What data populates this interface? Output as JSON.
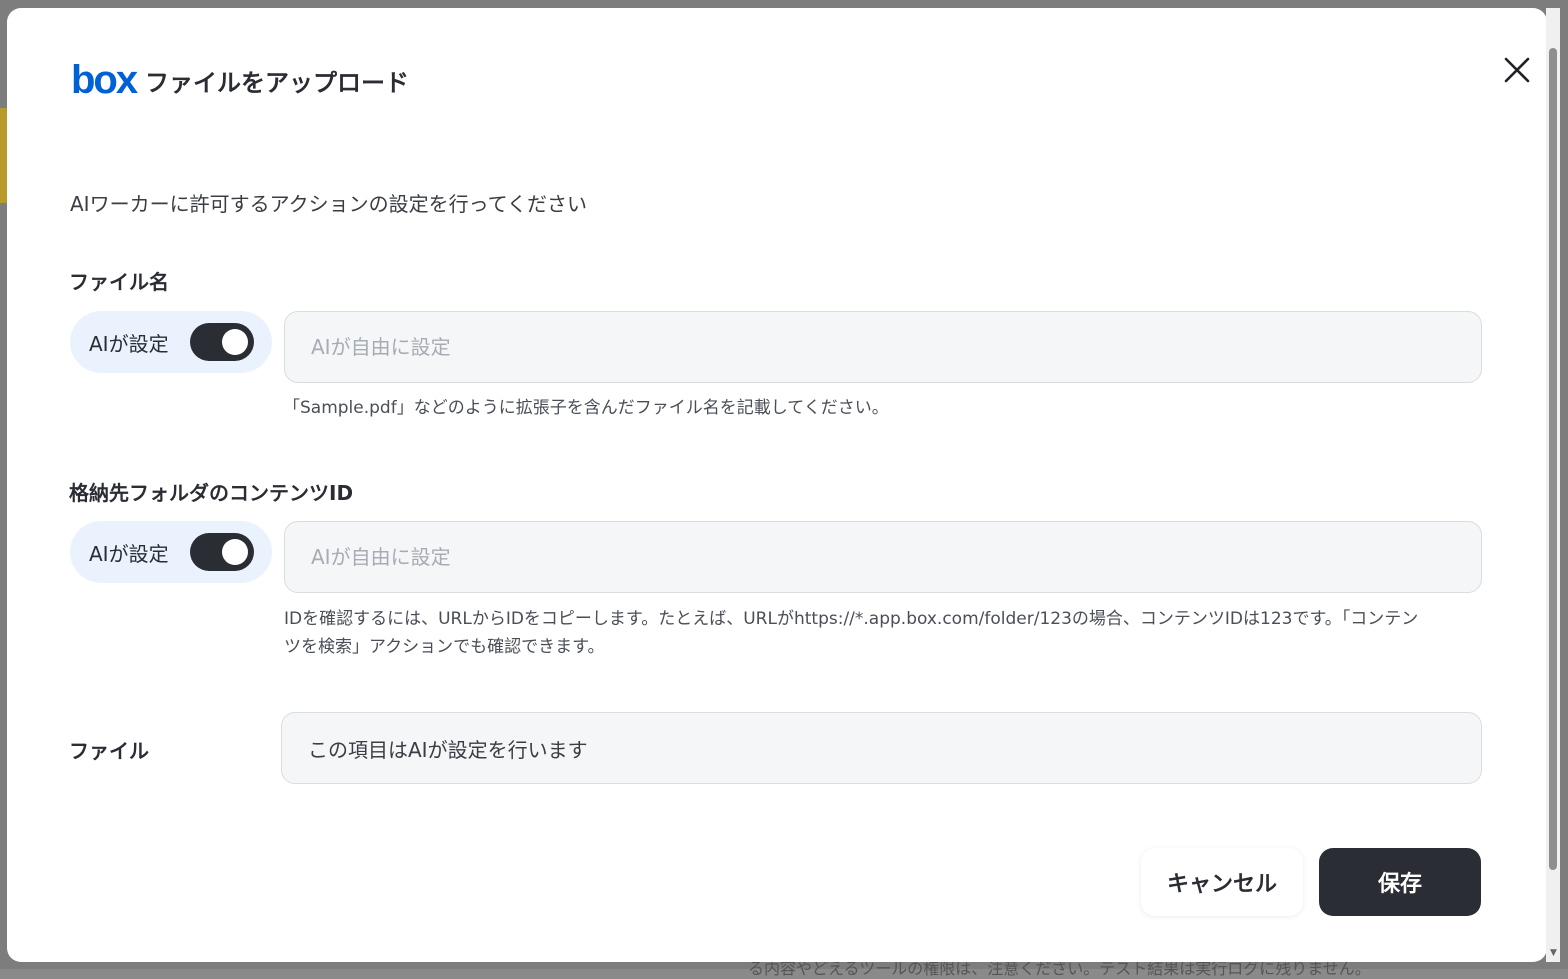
{
  "dialog": {
    "title": "ファイルをアップロード",
    "logo_text": "box",
    "description": "AIワーカーに許可するアクションの設定を行ってください",
    "close_icon": "close-icon"
  },
  "fields": {
    "file_name": {
      "label": "ファイル名",
      "ai_toggle_label": "AIが設定",
      "ai_toggle_on": true,
      "placeholder": "AIが自由に設定",
      "value": "",
      "hint": "「Sample.pdf」などのように拡張子を含んだファイル名を記載してください。"
    },
    "folder_id": {
      "label": "格納先フォルダのコンテンツID",
      "ai_toggle_label": "AIが設定",
      "ai_toggle_on": true,
      "placeholder": "AIが自由に設定",
      "value": "",
      "hint_line1": "IDを確認するには、URLからIDをコピーします。たとえば、URLがhttps://*.app.box.com/folder/123の場合、コンテンツIDは123です。「コンテン",
      "hint_line2": "ツを検索」アクションでも確認できます。"
    },
    "file": {
      "label": "ファイル",
      "readonly_text": "この項目はAIが設定を行います"
    }
  },
  "footer": {
    "cancel_label": "キャンセル",
    "save_label": "保存"
  },
  "background": {
    "partial_text": "る内容やどえるツールの権限は、注意ください。テスト結果は実行ログに残りません。"
  },
  "colors": {
    "brand_blue": "#0061d5",
    "primary_dark": "#2a2d33",
    "pill_bg": "#eaf3fd",
    "input_bg": "#f5f6f8"
  }
}
